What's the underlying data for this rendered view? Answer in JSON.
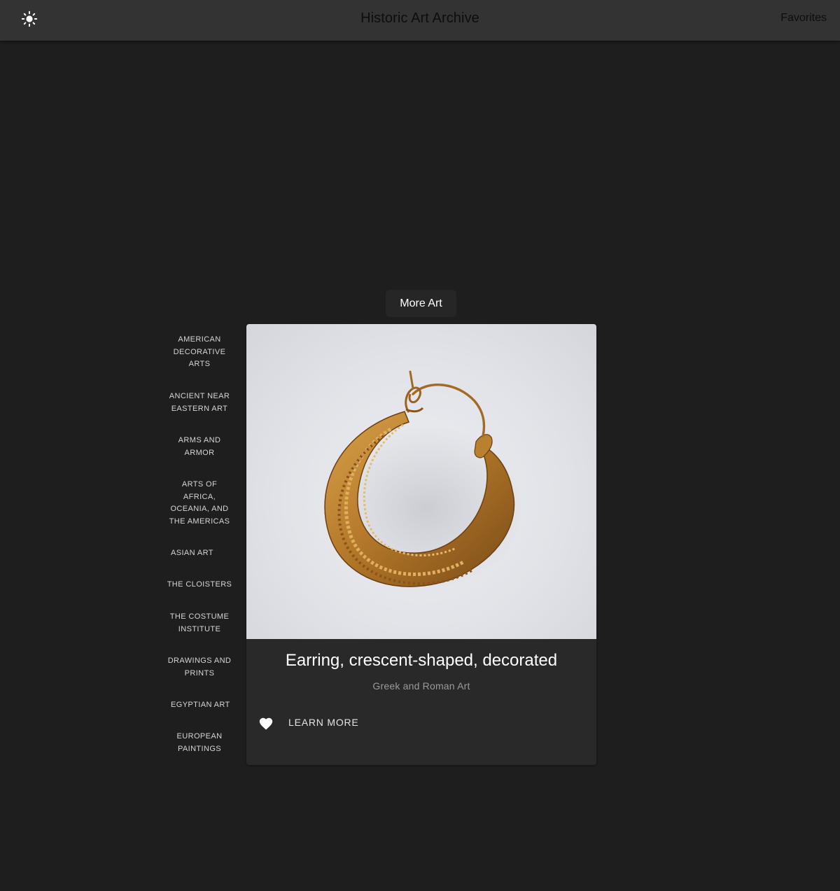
{
  "header": {
    "title": "Historic Art Archive",
    "favorites_label": "Favorites",
    "theme_icon": "sun-icon"
  },
  "more_art_label": "More Art",
  "departments": [
    "American Decorative Arts",
    "Ancient Near Eastern Art",
    "Arms and Armor",
    "Arts of Africa, Oceania, and the Americas",
    "Asian Art",
    "The Cloisters",
    "The Costume Institute",
    "Drawings and Prints",
    "Egyptian Art",
    "European Paintings"
  ],
  "artwork": {
    "title": "Earring, crescent-shaped, decorated",
    "department": "Greek and Roman Art",
    "learn_more_label": "Learn More",
    "favorite_icon": "heart-icon"
  },
  "colors": {
    "background": "#1e1e1e",
    "appbar": "#333333",
    "card": "#292929",
    "gold": "#b8802e"
  }
}
